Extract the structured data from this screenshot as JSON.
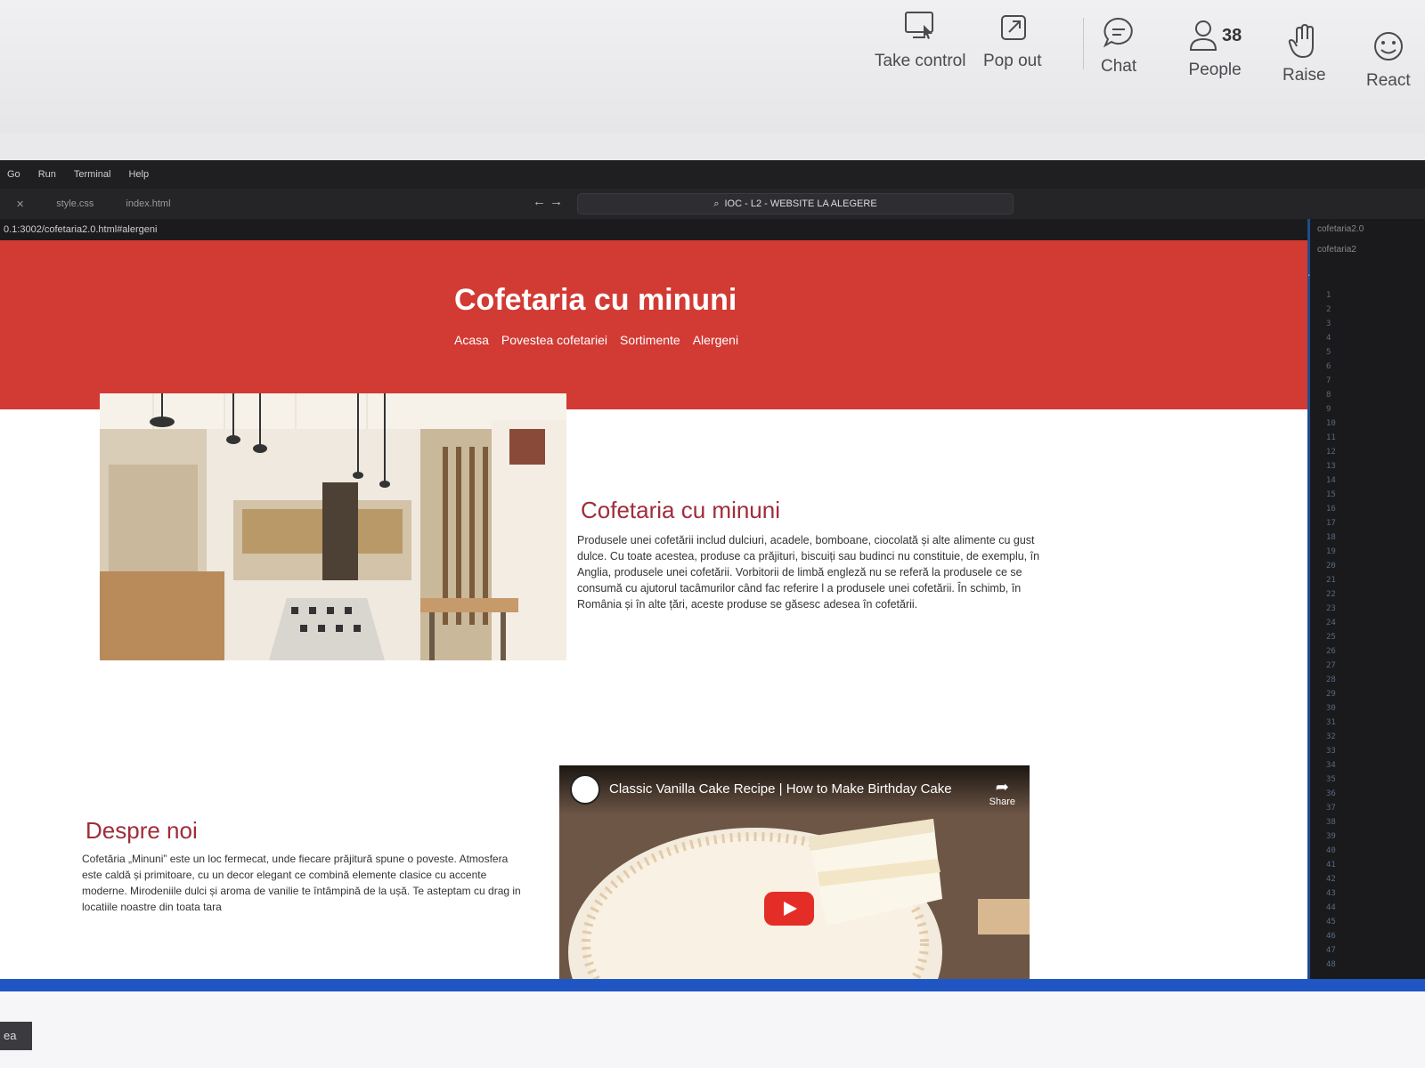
{
  "teams_toolbar": {
    "take_control": "Take control",
    "pop_out": "Pop out",
    "chat": "Chat",
    "people": "People",
    "people_count": "38",
    "raise": "Raise",
    "react": "React"
  },
  "vscode": {
    "menu": [
      "Go",
      "Run",
      "Terminal",
      "Help"
    ],
    "tabs": [
      "style.css",
      "index.html"
    ],
    "search_title": "IOC - L2 - WEBSITE LA ALEGERE",
    "url": "0.1:3002/cofetaria2.0.html#alergeni",
    "explorer_items": [
      "cofetaria2.0",
      "cofetaria2"
    ]
  },
  "site": {
    "title": "Cofetaria cu minuni",
    "nav": [
      "Acasa",
      "Povestea cofetariei",
      "Sortimente",
      "Alergeni"
    ],
    "intro_title": "Cofetaria cu minuni",
    "intro_text": "Produsele unei cofetării includ dulciuri, acadele, bomboane, ciocolată și alte alimente cu gust dulce. Cu toate acestea, produse ca prăjituri, biscuiți sau budinci nu constituie, de exemplu, în Anglia, produsele unei cofetării. Vorbitorii de limbă engleză nu se referă la produsele ce se consumă cu ajutorul tacâmurilor când fac referire l a produsele unei cofetării. În schimb, în România și în alte țări, aceste produse se găsesc adesea în cofetării.",
    "about_title": "Despre noi",
    "about_text": "Cofetăria „Minuni” este un loc fermecat, unde fiecare prăjitură spune o poveste. Atmosfera este caldă și primitoare, cu un decor elegant ce combină elemente clasice cu accente moderne. Mirodeniile dulci și aroma de vanilie te întâmpină de la ușă. Te asteptam cu drag in locatiile noastre din toata tara",
    "video_title": "Classic Vanilla Cake Recipe | How to Make Birthday Cake",
    "video_share": "Share"
  },
  "corner_text": "ea",
  "colors": {
    "header_red": "#d23a34",
    "heading_maroon": "#a12c3a",
    "accent_blue": "#1f56c4"
  }
}
